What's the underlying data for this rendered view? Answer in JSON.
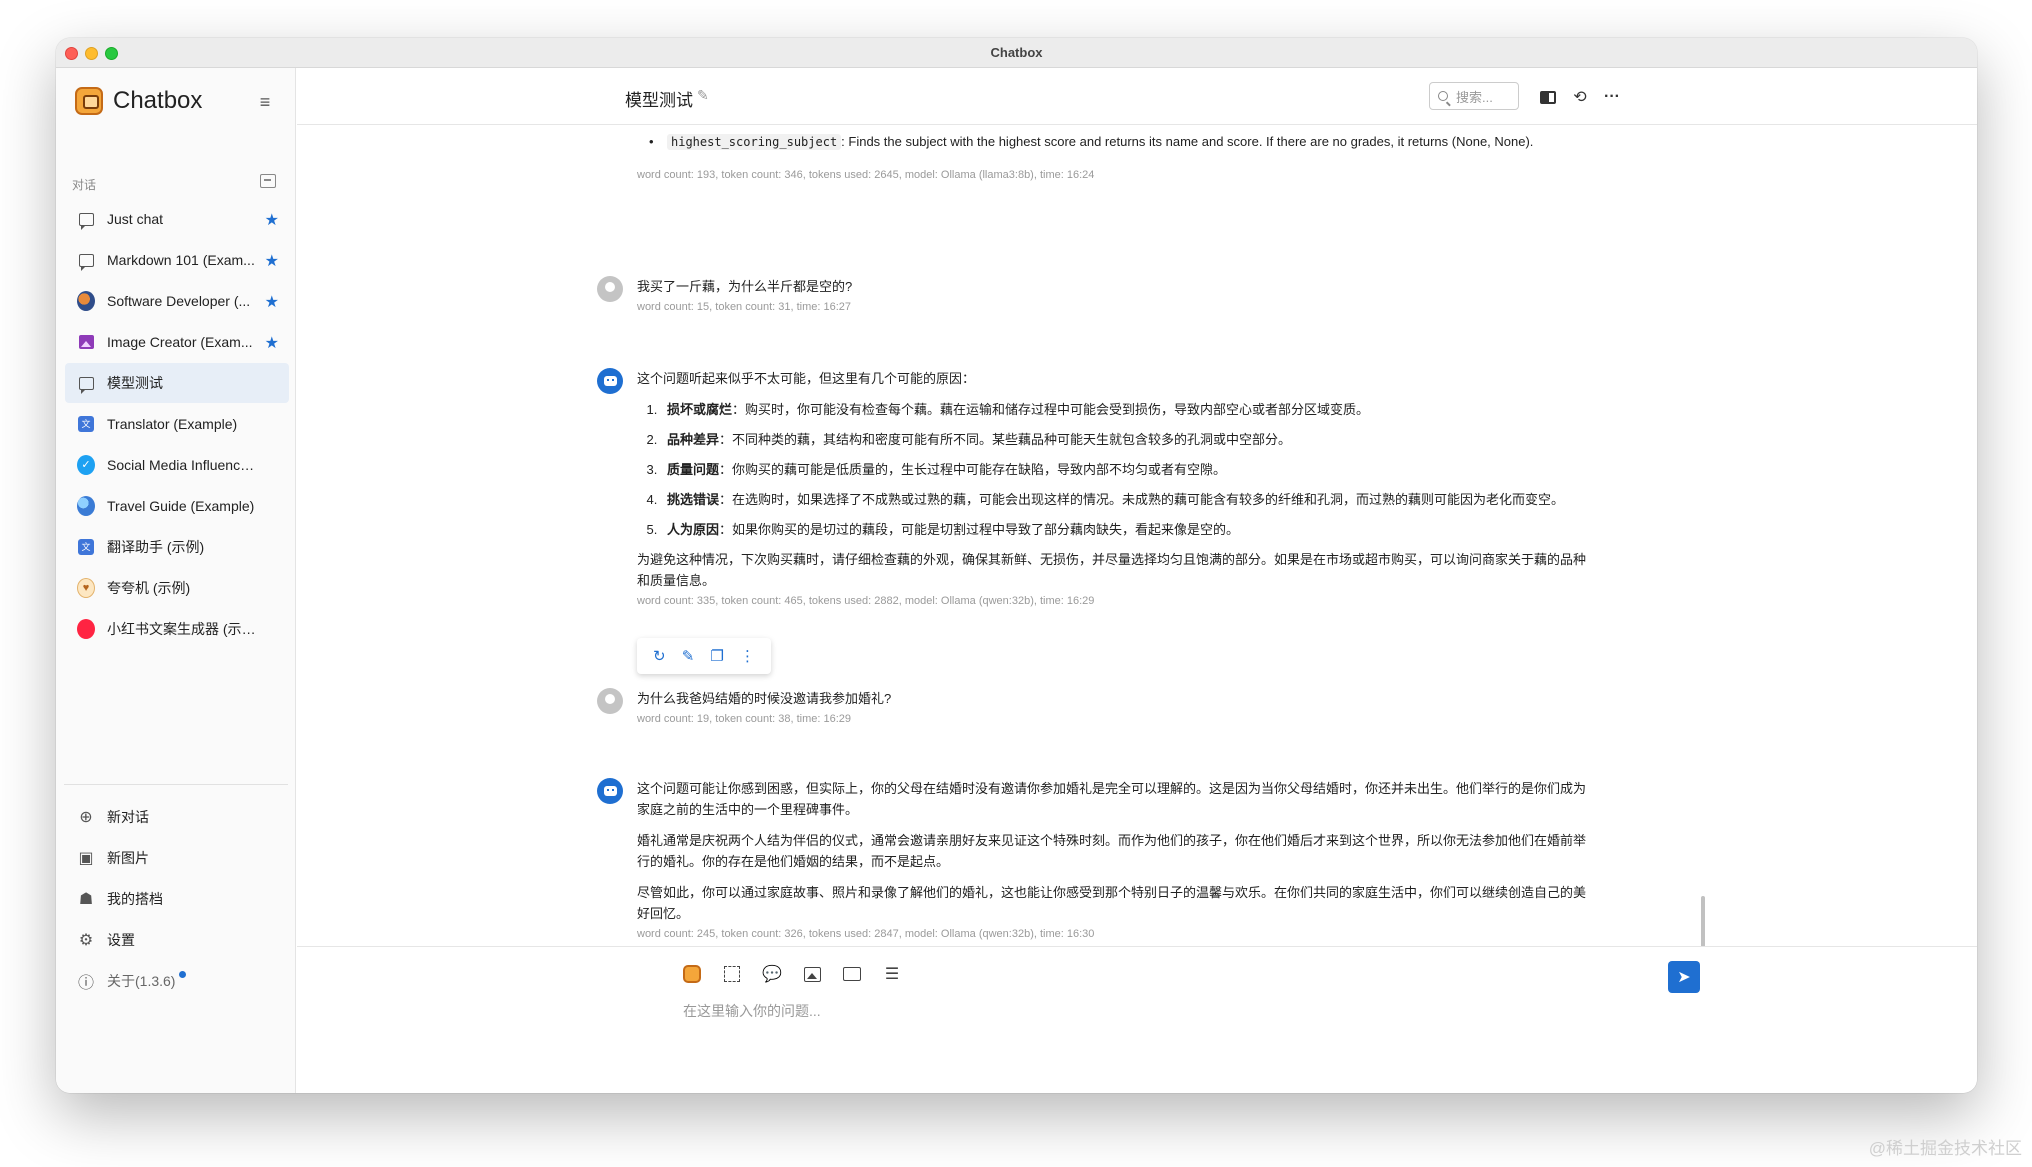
{
  "window": {
    "title": "Chatbox"
  },
  "sidebar": {
    "brand": "Chatbox",
    "section_label": "对话",
    "conversations": [
      {
        "label": "Just chat",
        "icon": "chat-bubble-icon",
        "starred": true
      },
      {
        "label": "Markdown 101 (Exam...",
        "icon": "chat-bubble-icon",
        "starred": true
      },
      {
        "label": "Software Developer (...",
        "icon": "developer-avatar",
        "starred": true
      },
      {
        "label": "Image Creator (Exam...",
        "icon": "image-icon",
        "starred": true
      },
      {
        "label": "模型测试",
        "icon": "chat-bubble-icon",
        "starred": false,
        "active": true
      },
      {
        "label": "Translator (Example)",
        "icon": "translator-avatar",
        "starred": false
      },
      {
        "label": "Social Media Influencer (E...",
        "icon": "twitter-avatar",
        "starred": false
      },
      {
        "label": "Travel Guide (Example)",
        "icon": "globe-avatar",
        "starred": false
      },
      {
        "label": "翻译助手 (示例)",
        "icon": "translator-avatar",
        "starred": false
      },
      {
        "label": "夸夸机 (示例)",
        "icon": "praise-avatar",
        "starred": false
      },
      {
        "label": "小红书文案生成器 (示例)",
        "icon": "xiaohongshu-avatar",
        "starred": false
      }
    ],
    "menu": {
      "new_chat": "新对话",
      "new_image": "新图片",
      "my_copilots": "我的搭档",
      "settings": "设置",
      "about": "关于(1.3.6)"
    }
  },
  "header": {
    "title": "模型测试",
    "search_placeholder": "搜索..."
  },
  "messages": {
    "m1": {
      "code": "highest_scoring_subject",
      "text": ": Finds the subject with the highest score and returns its name and score. If there are no grades, it returns (None, None).",
      "meta": "word count: 193, token count: 346, tokens used: 2645, model: Ollama (llama3:8b), time: 16:24"
    },
    "m2": {
      "text": "我买了一斤藕，为什么半斤都是空的?",
      "meta": "word count: 15, token count: 31, time: 16:27"
    },
    "m3": {
      "intro": "这个问题听起来似乎不太可能，但这里有几个可能的原因：",
      "items": [
        {
          "bold": "损坏或腐烂",
          "text": "：购买时，你可能没有检查每个藕。藕在运输和储存过程中可能会受到损伤，导致内部空心或者部分区域变质。"
        },
        {
          "bold": "品种差异",
          "text": "：不同种类的藕，其结构和密度可能有所不同。某些藕品种可能天生就包含较多的孔洞或中空部分。"
        },
        {
          "bold": "质量问题",
          "text": "：你购买的藕可能是低质量的，生长过程中可能存在缺陷，导致内部不均匀或者有空隙。"
        },
        {
          "bold": "挑选错误",
          "text": "：在选购时，如果选择了不成熟或过熟的藕，可能会出现这样的情况。未成熟的藕可能含有较多的纤维和孔洞，而过熟的藕则可能因为老化而变空。"
        },
        {
          "bold": "人为原因",
          "text": "：如果你购买的是切过的藕段，可能是切割过程中导致了部分藕肉缺失，看起来像是空的。"
        }
      ],
      "outro": "为避免这种情况，下次购买藕时，请仔细检查藕的外观，确保其新鲜、无损伤，并尽量选择均匀且饱满的部分。如果是在市场或超市购买，可以询问商家关于藕的品种和质量信息。",
      "meta": "word count: 335, token count: 465, tokens used: 2882, model: Ollama (qwen:32b), time: 16:29"
    },
    "m4": {
      "text": "为什么我爸妈结婚的时候没邀请我参加婚礼?",
      "meta": "word count: 19, token count: 38, time: 16:29"
    },
    "m5": {
      "p1": "这个问题可能让你感到困惑，但实际上，你的父母在结婚时没有邀请你参加婚礼是完全可以理解的。这是因为当你父母结婚时，你还并未出生。他们举行的是你们成为家庭之前的生活中的一个里程碑事件。",
      "p2": "婚礼通常是庆祝两个人结为伴侣的仪式，通常会邀请亲朋好友来见证这个特殊时刻。而作为他们的孩子，你在他们婚后才来到这个世界，所以你无法参加他们在婚前举行的婚礼。你的存在是他们婚姻的结果，而不是起点。",
      "p3": "尽管如此，你可以通过家庭故事、照片和录像了解他们的婚礼，这也能让你感受到那个特别日子的温馨与欢乐。在你们共同的家庭生活中，你们可以继续创造自己的美好回忆。",
      "meta": "word count: 245, token count: 326, tokens used: 2847, model: Ollama (qwen:32b), time: 16:30"
    }
  },
  "composer": {
    "placeholder": "在这里输入你的问题..."
  },
  "watermark": "@稀土掘金技术社区",
  "colors": {
    "accent": "#1f6fd1",
    "active_item": "#e7eef7"
  }
}
